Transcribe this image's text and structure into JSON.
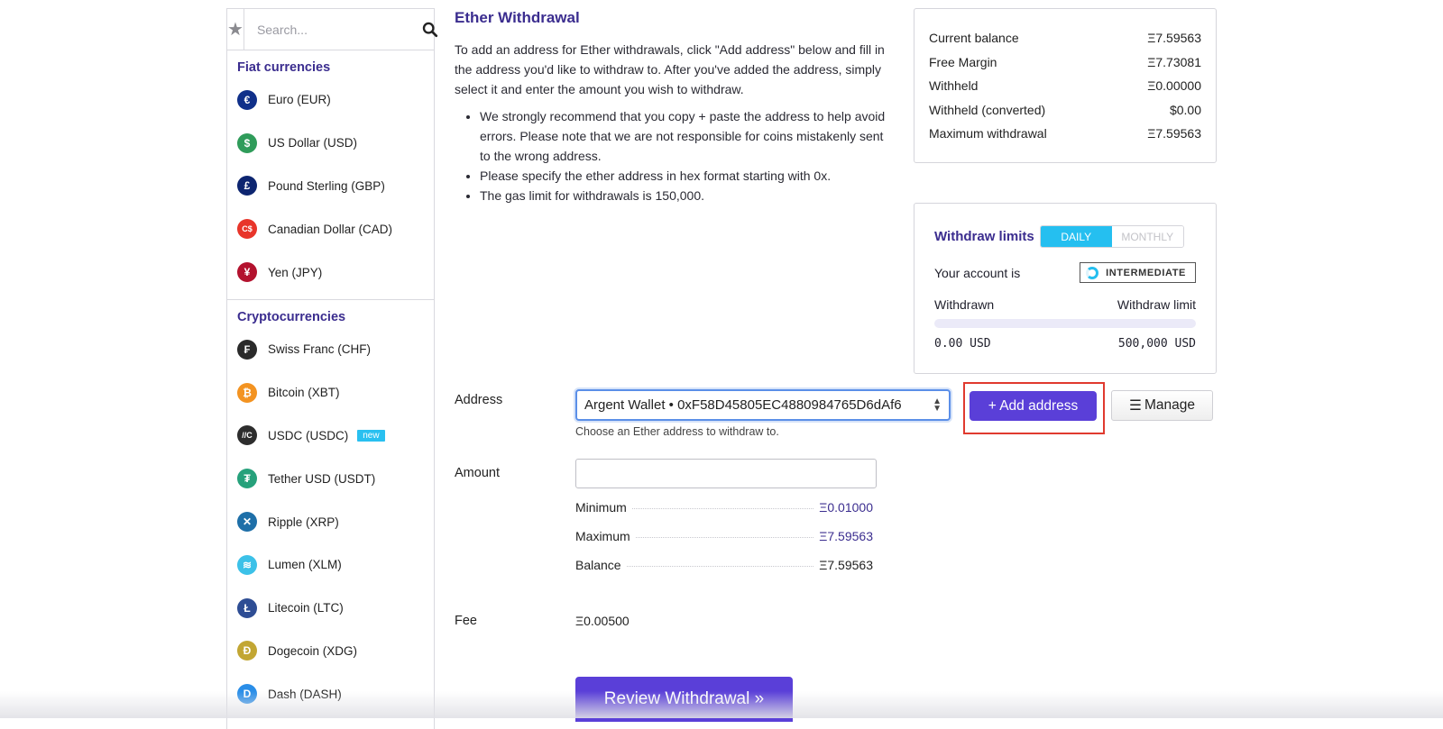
{
  "sidebar": {
    "search_placeholder": "Search...",
    "favorites_icon": "star-icon",
    "search_icon": "search-icon",
    "fiat_title": "Fiat currencies",
    "fiat": [
      {
        "label": "Euro (EUR)",
        "icon": "euro-icon",
        "symbol": "€",
        "color": "#10308a"
      },
      {
        "label": "US Dollar (USD)",
        "icon": "dollar-icon",
        "symbol": "$",
        "color": "#2f9c5a"
      },
      {
        "label": "Pound Sterling (GBP)",
        "icon": "pound-icon",
        "symbol": "£",
        "color": "#0d2570"
      },
      {
        "label": "Canadian Dollar (CAD)",
        "icon": "cad-icon",
        "symbol": "C$",
        "color": "#e8352a"
      },
      {
        "label": "Yen (JPY)",
        "icon": "yen-icon",
        "symbol": "¥",
        "color": "#b3122e"
      }
    ],
    "crypto_title": "Cryptocurrencies",
    "crypto": [
      {
        "label": "Swiss Franc (CHF)",
        "icon": "franc-icon",
        "symbol": "₣",
        "color": "#2a2a2a"
      },
      {
        "label": "Bitcoin (XBT)",
        "icon": "bitcoin-icon",
        "symbol": "₿",
        "color": "#f39321"
      },
      {
        "label": "USDC (USDC)",
        "icon": "usdc-icon",
        "symbol": "//C",
        "color": "#2d2d2d",
        "badge": "new"
      },
      {
        "label": "Tether USD (USDT)",
        "icon": "tether-icon",
        "symbol": "₮",
        "color": "#26a17b"
      },
      {
        "label": "Ripple (XRP)",
        "icon": "ripple-icon",
        "symbol": "✕",
        "color": "#1e6fa8"
      },
      {
        "label": "Lumen (XLM)",
        "icon": "lumen-icon",
        "symbol": "≋",
        "color": "#3cc1e8"
      },
      {
        "label": "Litecoin (LTC)",
        "icon": "litecoin-icon",
        "symbol": "Ł",
        "color": "#2e4d94"
      },
      {
        "label": "Dogecoin (XDG)",
        "icon": "dogecoin-icon",
        "symbol": "Ð",
        "color": "#c2a633"
      },
      {
        "label": "Dash (DASH)",
        "icon": "dash-icon",
        "symbol": "D",
        "color": "#2a8ee8"
      }
    ]
  },
  "main": {
    "title": "Ether Withdrawal",
    "intro": "To add an address for Ether withdrawals, click \"Add address\" below and fill in the address you'd like to withdraw to. After you've added the address, simply select it and enter the amount you wish to withdraw.",
    "bullets": [
      "We strongly recommend that you copy + paste the address to help avoid errors. Please note that we are not responsible for coins mistakenly sent to the wrong address.",
      "Please specify the ether address in hex format starting with 0x.",
      "The gas limit for withdrawals is 150,000."
    ]
  },
  "balance": {
    "rows": [
      {
        "label": "Current balance",
        "value": "Ξ7.59563"
      },
      {
        "label": "Free Margin",
        "value": "Ξ7.73081"
      },
      {
        "label": "Withheld",
        "value": "Ξ0.00000"
      },
      {
        "label": "Withheld (converted)",
        "value": "$0.00"
      },
      {
        "label": "Maximum withdrawal",
        "value": "Ξ7.59563"
      }
    ]
  },
  "limits": {
    "title": "Withdraw limits",
    "tabs": [
      {
        "label": "DAILY",
        "active": true
      },
      {
        "label": "MONTHLY",
        "active": false
      }
    ],
    "account_label": "Your account is",
    "tier": "INTERMEDIATE",
    "withdrawn_label": "Withdrawn",
    "limit_label": "Withdraw limit",
    "withdrawn_value": "0.00 USD",
    "limit_value": "500,000 USD",
    "progress_fraction": 0.0
  },
  "form": {
    "address_label": "Address",
    "address_value": "Argent Wallet • 0xF58D45805EC4880984765D6dAf6",
    "address_hint": "Choose an Ether address to withdraw to.",
    "add_address_label": "+ Add address",
    "manage_label": "Manage",
    "amount_label": "Amount",
    "amount_value": "",
    "min_label": "Minimum",
    "min_value": "Ξ0.01000",
    "max_label": "Maximum",
    "max_value": "Ξ7.59563",
    "balance_label": "Balance",
    "balance_value": "Ξ7.59563",
    "fee_label": "Fee",
    "fee_value": "Ξ0.00500",
    "review_label": "Review Withdrawal »"
  }
}
